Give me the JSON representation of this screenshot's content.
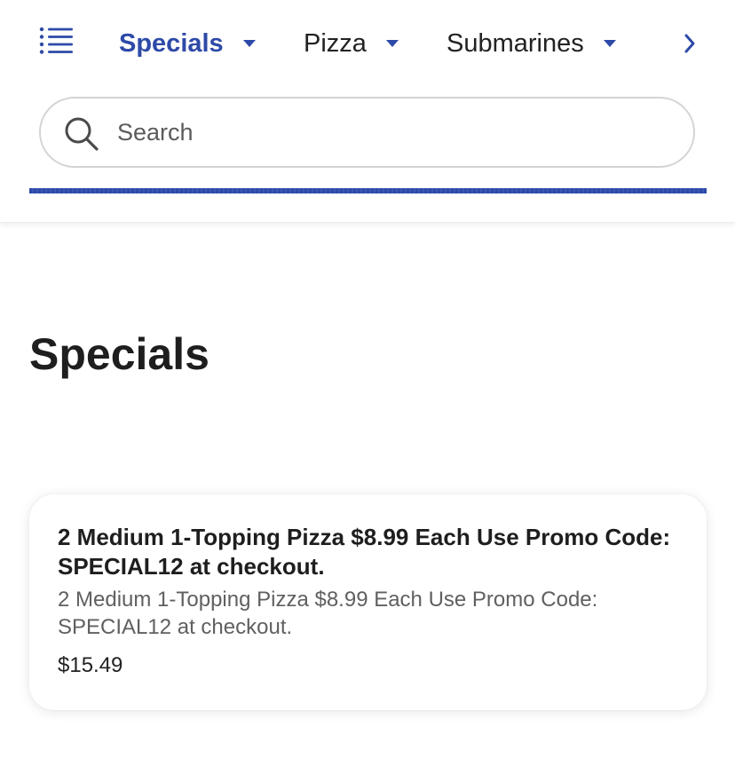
{
  "colors": {
    "accent": "#2e4aa8",
    "text_primary": "#1e1e1e",
    "text_secondary": "#606060",
    "border": "#d4d4d4"
  },
  "header": {
    "menu_icon": "list-menu-icon",
    "tabs": [
      {
        "label": "Specials",
        "active": true,
        "icon": "caret-down-icon"
      },
      {
        "label": "Pizza",
        "active": false,
        "icon": "caret-down-icon"
      },
      {
        "label": "Submarines",
        "active": false,
        "icon": "caret-down-icon"
      }
    ],
    "next_icon": "chevron-right-icon"
  },
  "search": {
    "placeholder": "Search",
    "value": "",
    "icon": "search-icon"
  },
  "main": {
    "title": "Specials",
    "items": [
      {
        "title": "2 Medium 1-Topping  Pizza $8.99 Each Use Promo Code: SPECIAL12 at checkout.",
        "description": "2 Medium 1-Topping  Pizza $8.99 Each Use Promo Code: SPECIAL12 at checkout.",
        "price": "$15.49"
      }
    ]
  }
}
